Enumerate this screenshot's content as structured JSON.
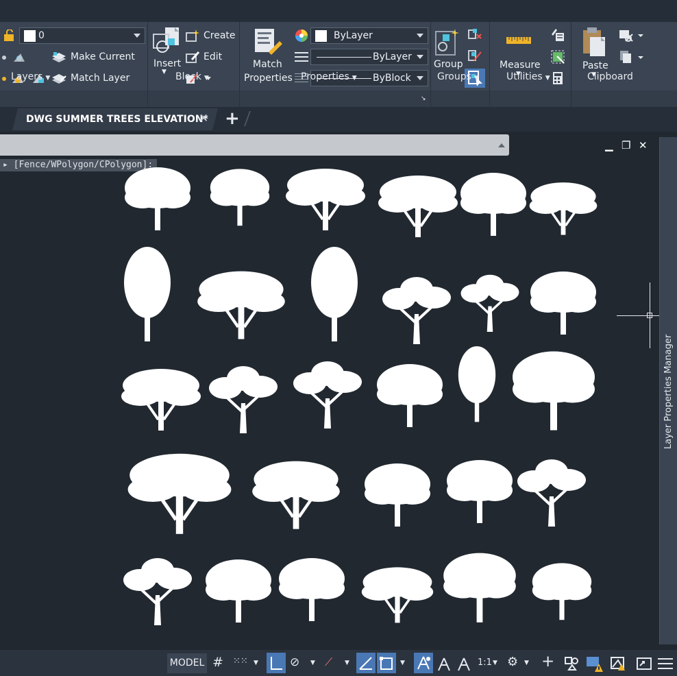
{
  "ribbon": {
    "layers": {
      "current_layer": "0",
      "make_current": "Make Current",
      "match_layer": "Match Layer",
      "title": "Layers"
    },
    "block": {
      "insert": "Insert",
      "create": "Create",
      "edit": "Edit",
      "title": "Block"
    },
    "properties": {
      "match_properties_line1": "Match",
      "match_properties_line2": "Properties",
      "color_value": "ByLayer",
      "linetype_value": "ByLayer",
      "lineweight_value": "ByBlock",
      "title": "Properties"
    },
    "groups": {
      "group": "Group",
      "title": "Groups"
    },
    "utilities": {
      "measure": "Measure",
      "title": "Utilities"
    },
    "clipboard": {
      "paste": "Paste",
      "title": "Clipboard"
    }
  },
  "tabs": [
    {
      "label": "DWG SUMMER TREES ELEVATION*"
    }
  ],
  "command": {
    "prompt": "[Fence/WPolygon/CPolygon]:"
  },
  "palette": {
    "label": "Layer Properties Manager"
  },
  "status": {
    "model": "MODEL",
    "scale": "1:1"
  },
  "colors": {
    "background": "#212830",
    "ribbon": "#3a4452",
    "active_toggle": "#4a78b5",
    "tree_fill": "#ffffff"
  },
  "drawing": {
    "tree_blocks_count": 29,
    "rows": 5
  }
}
